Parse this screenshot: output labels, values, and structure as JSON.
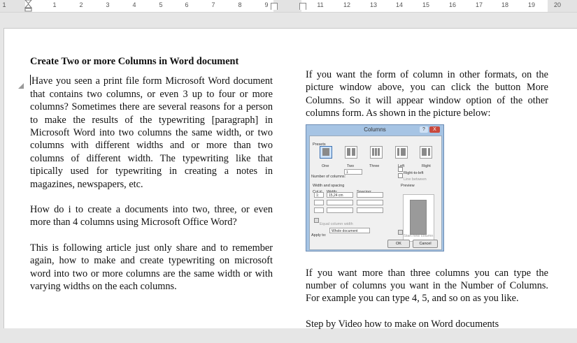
{
  "ruler": {
    "numbers_left": [
      "1",
      "1",
      "2",
      "3",
      "4",
      "5",
      "6",
      "7",
      "8",
      "9"
    ],
    "numbers_right": [
      "11",
      "12",
      "13",
      "14",
      "15",
      "16",
      "17",
      "18",
      "19",
      "20"
    ]
  },
  "left_column": {
    "heading": "Create Two or more Columns in Word document",
    "paragraphs": [
      "Have you seen a print file form Microsoft Word document that contains two columns, or even 3 up to four or more columns? Sometimes there are several reasons for a person to make the results of the typewriting [paragraph] in Microsoft Word into two columns the same width, or two columns with different widths and or more than two columns of different width. The typewriting like that tipically used for typewriting in creating a notes in magazines, newspapers, etc.",
      "How do i to create a documents into two, three, or even more than 4 columns using Microsoft Office Word?",
      "This is following article just only share and to remember again, how to make and create typewriting on microsoft word into two or more columns are the same width or with varying widths on the each columns."
    ]
  },
  "right_column": {
    "paragraphs": [
      "If you want the form of column in other formats, on the picture window above, you can click the button More Columns. So it will appear window option of the other columns form. As shown in the picture below:",
      "If you want more than three columns you can type the number of columns you want in the Number of Columns. For example you can type 4, 5, and so on as you like.",
      "Step by Video how to make on Word documents"
    ]
  },
  "dialog": {
    "title": "Columns",
    "help": "?",
    "close": "X",
    "presets_label": "Presets",
    "presets": [
      "One",
      "Two",
      "Three",
      "Left",
      "Right"
    ],
    "number_of_columns_label": "Number of columns:",
    "number_of_columns_value": "1",
    "line_between_label": "Line between",
    "width_spacing_label": "Width and spacing",
    "col_label": "Col #:",
    "width_label": "Width:",
    "spacing_label": "Spacing:",
    "row1_col": "1:",
    "row1_width": "15,24 cm",
    "equal_width_label": "Equal column width",
    "right_to_left_label": "Right-to-left",
    "preview_label": "Preview",
    "apply_to_label": "Apply to:",
    "apply_to_value": "Whole document",
    "start_new_column_label": "Start new column",
    "ok": "OK",
    "cancel": "Cancel"
  }
}
